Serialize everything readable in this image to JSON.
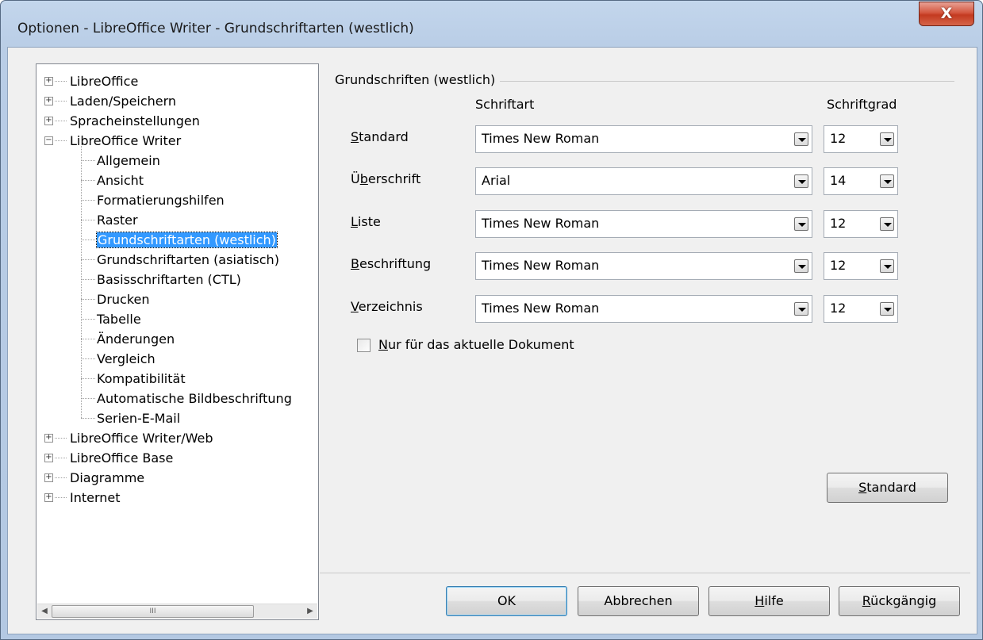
{
  "window": {
    "title": "Optionen - LibreOffice Writer - Grundschriftarten (westlich)",
    "close_glyph": "X"
  },
  "tree": {
    "items": [
      {
        "label": "LibreOffice",
        "level": 0,
        "expander": "+"
      },
      {
        "label": "Laden/Speichern",
        "level": 0,
        "expander": "+"
      },
      {
        "label": "Spracheinstellungen",
        "level": 0,
        "expander": "+"
      },
      {
        "label": "LibreOffice Writer",
        "level": 0,
        "expander": "−"
      },
      {
        "label": "Allgemein",
        "level": 1
      },
      {
        "label": "Ansicht",
        "level": 1
      },
      {
        "label": "Formatierungshilfen",
        "level": 1
      },
      {
        "label": "Raster",
        "level": 1
      },
      {
        "label": "Grundschriftarten (westlich)",
        "level": 1,
        "selected": true
      },
      {
        "label": "Grundschriftarten (asiatisch)",
        "level": 1
      },
      {
        "label": "Basisschriftarten (CTL)",
        "level": 1
      },
      {
        "label": "Drucken",
        "level": 1
      },
      {
        "label": "Tabelle",
        "level": 1
      },
      {
        "label": "Änderungen",
        "level": 1
      },
      {
        "label": "Vergleich",
        "level": 1
      },
      {
        "label": "Kompatibilität",
        "level": 1
      },
      {
        "label": "Automatische Bildbeschriftung",
        "level": 1
      },
      {
        "label": "Serien-E-Mail",
        "level": 1
      },
      {
        "label": "LibreOffice Writer/Web",
        "level": 0,
        "expander": "+"
      },
      {
        "label": "LibreOffice Base",
        "level": 0,
        "expander": "+"
      },
      {
        "label": "Diagramme",
        "level": 0,
        "expander": "+"
      },
      {
        "label": "Internet",
        "level": 0,
        "expander": "+"
      }
    ],
    "scroll_left": "◀",
    "scroll_right": "▶",
    "scroll_grip": "III"
  },
  "panel": {
    "group_title": "Grundschriften (westlich)",
    "col_font": "Schriftart",
    "col_size_pre": "Schrift",
    "col_size_key": "g",
    "col_size_post": "rad",
    "rows": [
      {
        "key": "S",
        "rest": "tandard",
        "font": "Times New Roman",
        "size": "12"
      },
      {
        "pre": "Ü",
        "key": "b",
        "rest": "erschrift",
        "font": "Arial",
        "size": "14"
      },
      {
        "key": "L",
        "rest": "iste",
        "font": "Times New Roman",
        "size": "12"
      },
      {
        "key": "B",
        "rest": "eschriftung",
        "font": "Times New Roman",
        "size": "12"
      },
      {
        "key": "V",
        "rest": "erzeichnis",
        "font": "Times New Roman",
        "size": "12"
      }
    ],
    "checkbox_key": "N",
    "checkbox_rest": "ur für das aktuelle Dokument",
    "standard_key": "S",
    "standard_rest": "tandard"
  },
  "buttons": {
    "ok": "OK",
    "cancel": "Abbrechen",
    "help_key": "H",
    "help_rest": "ilfe",
    "reset_key": "R",
    "reset_rest": "ückgängig"
  }
}
